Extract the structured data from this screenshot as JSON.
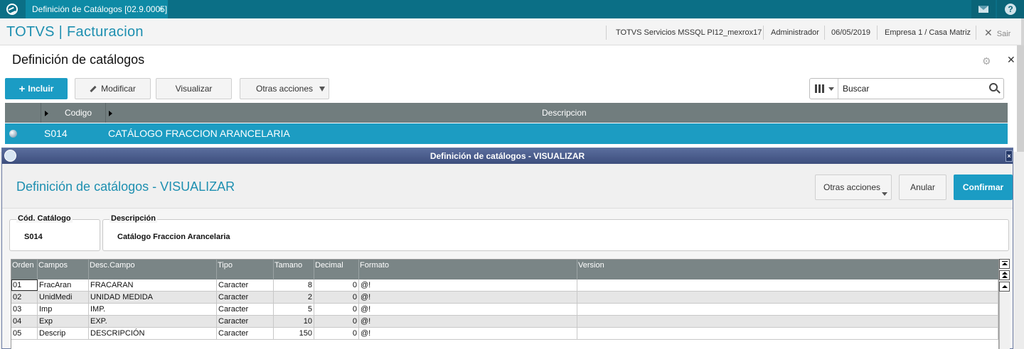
{
  "topbar": {
    "tab_title": "Definición de Catálogos [02.9.0005]",
    "tab_close": "×",
    "help_glyph": "?"
  },
  "app": {
    "brand": "TOTVS | Facturacion",
    "server": "TOTVS Servicios MSSQL PI12_mexrox17",
    "user": "Administrador",
    "date": "06/05/2019",
    "company": "Empresa 1 / Casa Matriz",
    "exit_label": "Sair"
  },
  "page": {
    "title": "Definición de catálogos",
    "toolbar": {
      "include_label": "Incluir",
      "modify_label": "Modificar",
      "view_label": "Visualizar",
      "other_actions_label": "Otras acciones"
    },
    "search": {
      "value": "Buscar"
    },
    "grid": {
      "columns": [
        "Codigo",
        "Descripcion"
      ],
      "rows": [
        {
          "codigo": "S014",
          "descripcion": "CATÁLOGO FRACCION ARANCELARIA"
        }
      ]
    }
  },
  "modal": {
    "window_title": "Definición de catálogos - VISUALIZAR",
    "heading": "Definición de catálogos - VISUALIZAR",
    "buttons": {
      "other_actions_label": "Otras acciones",
      "cancel_label": "Anular",
      "confirm_label": "Confirmar"
    },
    "fields": {
      "code_label": "Cód. Catálogo",
      "code_value": "S014",
      "desc_label": "Descripción",
      "desc_value": "Catálogo Fraccion Arancelaria"
    },
    "grid": {
      "columns": [
        "Orden",
        "Campos",
        "Desc.Campo",
        "Tipo",
        "Tamano",
        "Decimal",
        "Formato",
        "Version"
      ],
      "rows": [
        {
          "orden": "01",
          "campos": "FracAran",
          "desc": "FRACARAN",
          "tipo": "Caracter",
          "tamano": "8",
          "decimal": "0",
          "formato": "@!",
          "version": ""
        },
        {
          "orden": "02",
          "campos": "UnidMedi",
          "desc": "UNIDAD MEDIDA",
          "tipo": "Caracter",
          "tamano": "2",
          "decimal": "0",
          "formato": "@!",
          "version": ""
        },
        {
          "orden": "03",
          "campos": "Imp",
          "desc": "IMP.",
          "tipo": "Caracter",
          "tamano": "5",
          "decimal": "0",
          "formato": "@!",
          "version": ""
        },
        {
          "orden": "04",
          "campos": "Exp",
          "desc": "EXP.",
          "tipo": "Caracter",
          "tamano": "10",
          "decimal": "0",
          "formato": "@!",
          "version": ""
        },
        {
          "orden": "05",
          "campos": "Descrip",
          "desc": "DESCRIPCIÓN",
          "tipo": "Caracter",
          "tamano": "150",
          "decimal": "0",
          "formato": "@!",
          "version": ""
        }
      ]
    }
  },
  "colors": {
    "topbar": "#0b6f86",
    "brand": "#1d8fb0",
    "primary_button": "#1b9cc4",
    "selected_row": "#1c9cc2",
    "grid_header": "#717d7e",
    "modal_titlebar": "#4a5c8d"
  },
  "icons": [
    "totvs-logo-icon",
    "mail-icon",
    "help-icon",
    "close-icon",
    "plus-icon",
    "pencil-icon",
    "chevron-down-icon",
    "columns-icon",
    "search-icon",
    "gear-icon",
    "status-dot-icon"
  ]
}
